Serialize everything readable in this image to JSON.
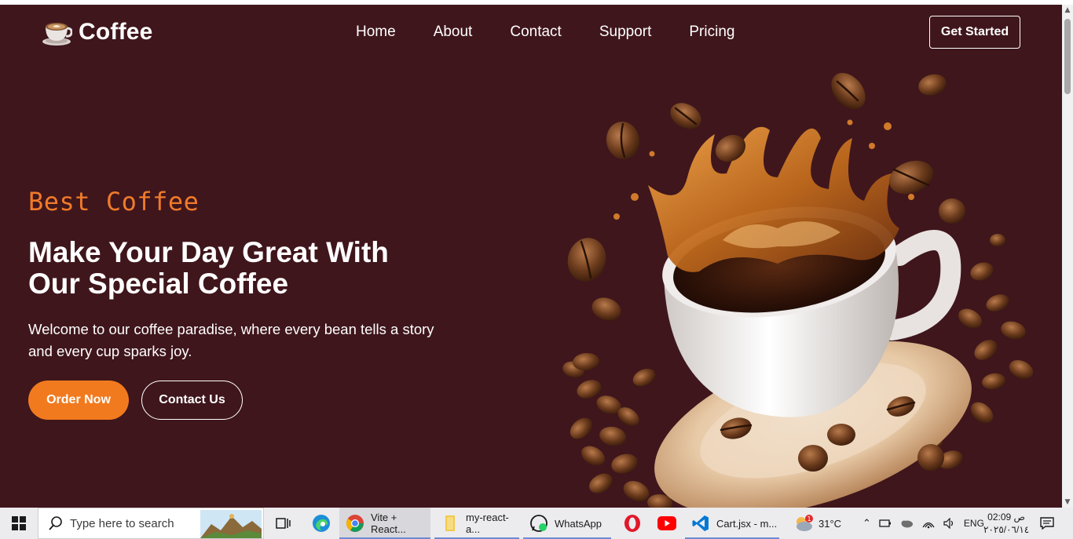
{
  "brand": {
    "name": "Coffee"
  },
  "nav": {
    "items": [
      {
        "label": "Home"
      },
      {
        "label": "About"
      },
      {
        "label": "Contact"
      },
      {
        "label": "Support"
      },
      {
        "label": "Pricing"
      }
    ],
    "cta": "Get Started"
  },
  "hero": {
    "eyebrow": "Best Coffee",
    "headline_line1": "Make Your Day Great With",
    "headline_line2": "Our Special Coffee",
    "lead": "Welcome to our coffee paradise, where every bean tells a story and every cup sparks joy.",
    "primary_button": "Order Now",
    "secondary_button": "Contact Us"
  },
  "colors": {
    "background": "#3f161c",
    "accent": "#f27a1e",
    "text": "#ffffff"
  },
  "taskbar": {
    "search_placeholder": "Type here to search",
    "apps": [
      {
        "label": "Vite + React...",
        "icon": "chrome-icon"
      },
      {
        "label": "my-react-a...",
        "icon": "folder-icon"
      },
      {
        "label": "WhatsApp",
        "icon": "whatsapp-icon"
      },
      {
        "label": "Cart.jsx - m...",
        "icon": "vscode-icon"
      }
    ],
    "weather": "31°C",
    "language": "ENG",
    "time": "02:09 ص",
    "date": "٢٠٢٥/٠٦/١٤"
  }
}
